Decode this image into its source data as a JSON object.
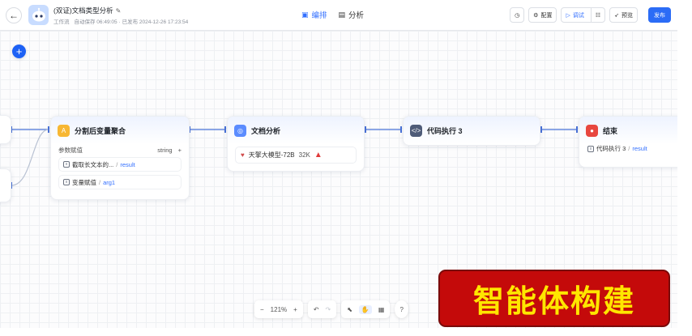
{
  "header": {
    "app_title": "(双证)文档类型分析",
    "meta_type": "工作流",
    "meta_autosave": "自动保存 06:49:05",
    "meta_published": "· 已发布 2024-12-26 17:23:54",
    "tabs": [
      {
        "label": "编排",
        "active": true
      },
      {
        "label": "分析",
        "active": false
      }
    ],
    "history_icon": "clock-icon",
    "config_label": "配置",
    "debug_label": "调试",
    "preview_label": "预览",
    "publish_label": "发布"
  },
  "nodes": {
    "aggregate": {
      "title": "分割后变量聚合",
      "param_label": "参数赋值",
      "param_type": "string",
      "add": "+",
      "items": [
        {
          "source": "截取长文本的...",
          "var": "result"
        },
        {
          "source": "变量赋值",
          "var": "arg1"
        }
      ]
    },
    "doc_analysis": {
      "title": "文档分析",
      "model": "天擎大模型-72B",
      "context": "32K",
      "warning_icon": "warning-icon"
    },
    "code_exec": {
      "title": "代码执行 3"
    },
    "end": {
      "title": "结束",
      "output_source": "代码执行 3",
      "output_var": "result"
    }
  },
  "toolbar": {
    "zoom_out": "−",
    "zoom": "121%",
    "zoom_in": "+",
    "undo": "↶",
    "redo": "↷",
    "pointer": "⬉",
    "hand": "✋",
    "layout": "▦",
    "help": "?"
  },
  "banner": {
    "text": "智能体构建"
  },
  "colors": {
    "accent": "#3370ff",
    "banner_bg": "#c40a0a",
    "banner_text": "#ffe600"
  }
}
